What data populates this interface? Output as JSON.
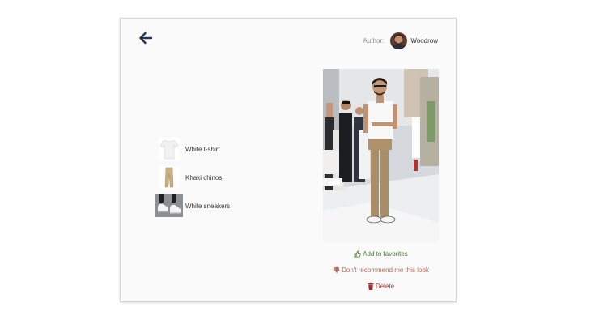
{
  "author": {
    "label": "Author:",
    "name": "Woodrow"
  },
  "items": [
    {
      "label": "White t-shirt",
      "icon": "tshirt-thumbnail"
    },
    {
      "label": "Khaki chinos",
      "icon": "chinos-thumbnail"
    },
    {
      "label": "White sneakers",
      "icon": "sneakers-thumbnail"
    }
  ],
  "actions": {
    "favorite": "Add to favorites",
    "dont_recommend": "Don't recommend me this look",
    "delete": "Delete"
  },
  "colors": {
    "back_arrow": "#1f3552",
    "favorite": "#4a7d3b",
    "dont_recommend": "#b06a5a",
    "delete": "#a62f2f"
  }
}
